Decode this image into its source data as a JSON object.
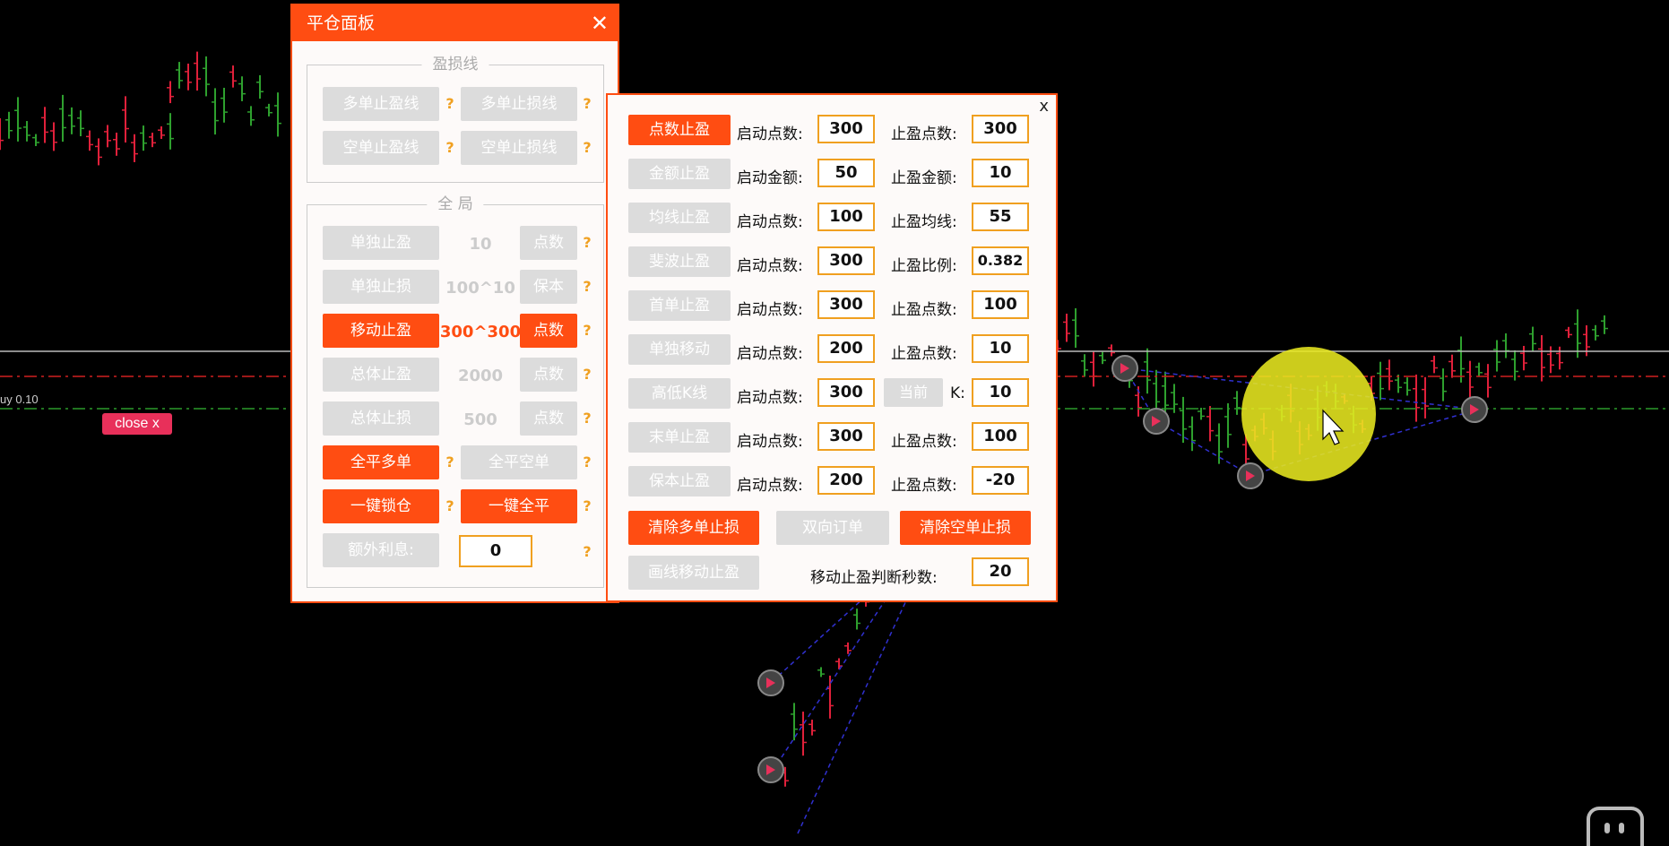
{
  "background": {
    "buy_label": "uy 0.10",
    "close_badge": "close x"
  },
  "panel1": {
    "title": "平仓面板",
    "close": "✕",
    "group1_label": "盈损线",
    "buttons": {
      "long_tp_line": "多单止盈线",
      "long_sl_line": "多单止损线",
      "short_tp_line": "空单止盈线",
      "short_sl_line": "空单止损线"
    },
    "group2_label": "全 局",
    "rows": [
      {
        "label": "单独止盈",
        "value": "10",
        "unit": "点数"
      },
      {
        "label": "单独止损",
        "value": "100^10",
        "unit": "保本"
      },
      {
        "label": "移动止盈",
        "value": "300^300",
        "unit": "点数"
      },
      {
        "label": "总体止盈",
        "value": "2000",
        "unit": "点数"
      },
      {
        "label": "总体止损",
        "value": "500",
        "unit": "点数"
      }
    ],
    "close_all_long": "全平多单",
    "close_all_short": "全平空单",
    "lock": "一键锁仓",
    "close_all": "一键全平",
    "extra_interest_label": "额外利息:",
    "extra_interest_value": "0",
    "help": "?"
  },
  "panel2": {
    "close": "x",
    "rows": [
      {
        "button": "点数止盈",
        "label1": "启动点数:",
        "value1": "300",
        "label2": "止盈点数:",
        "value2": "300"
      },
      {
        "button": "金额止盈",
        "label1": "启动金额:",
        "value1": "50",
        "label2": "止盈金额:",
        "value2": "10"
      },
      {
        "button": "均线止盈",
        "label1": "启动点数:",
        "value1": "100",
        "label2": "止盈均线:",
        "value2": "55"
      },
      {
        "button": "斐波止盈",
        "label1": "启动点数:",
        "value1": "300",
        "label2": "止盈比例:",
        "value2": "0.382"
      },
      {
        "button": "首单止盈",
        "label1": "启动点数:",
        "value1": "300",
        "label2": "止盈点数:",
        "value2": "100"
      },
      {
        "button": "单独移动",
        "label1": "启动点数:",
        "value1": "200",
        "label2": "止盈点数:",
        "value2": "10"
      },
      {
        "button": "高低K线",
        "label1": "启动点数:",
        "value1": "300",
        "current": "当前",
        "label2": "K:",
        "value2": "10"
      },
      {
        "button": "末单止盈",
        "label1": "启动点数:",
        "value1": "300",
        "label2": "止盈点数:",
        "value2": "100"
      },
      {
        "button": "保本止盈",
        "label1": "启动点数:",
        "value1": "200",
        "label2": "止盈点数:",
        "value2": "-20"
      }
    ],
    "clear_long_sl": "清除多单止损",
    "two_way_order": "双向订单",
    "clear_short_sl": "清除空单止损",
    "draw_trailing": "画线移动止盈",
    "trailing_seconds_label": "移动止盈判断秒数:",
    "trailing_seconds_value": "20"
  },
  "colors": {
    "accent": "#ff4d12",
    "disabled": "#dcdcdc",
    "help": "#f0a020",
    "bull": "#2ea02e",
    "bear": "#e0203a",
    "highlight": "#e8e820"
  }
}
